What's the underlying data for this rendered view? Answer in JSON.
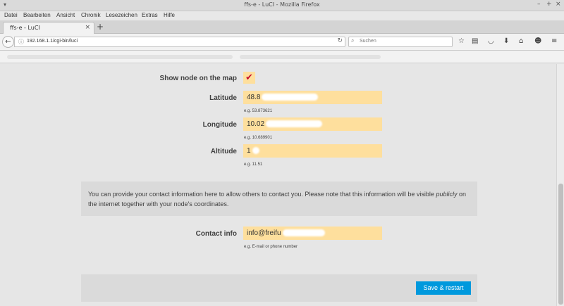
{
  "window": {
    "title": "ffs-e          - LuCI - Mozilla Firefox",
    "controls": [
      "–",
      "+",
      "×"
    ]
  },
  "menubar": [
    "Datei",
    "Bearbeiten",
    "Ansicht",
    "Chronik",
    "Lesezeichen",
    "Extras",
    "Hilfe"
  ],
  "tabs": [
    {
      "title": "ffs-e          - LuCI"
    }
  ],
  "newtab_label": "+",
  "navbar": {
    "url": "192.168.1.1/cgi-bin/luci",
    "search_placeholder": "Suchen",
    "icons": [
      "bookmark-star-icon",
      "library-icon",
      "pocket-icon",
      "download-icon",
      "home-icon",
      "emoji-icon",
      "hamburger-menu-icon"
    ]
  },
  "form": {
    "show_on_map": {
      "label": "Show node on the map",
      "checked": true,
      "mark": "✔"
    },
    "latitude": {
      "label": "Latitude",
      "value": "48.8",
      "hint": "e.g. 53.873621"
    },
    "longitude": {
      "label": "Longitude",
      "value": "10.02",
      "hint": "e.g. 10.689901"
    },
    "altitude": {
      "label": "Altitude",
      "value": "1",
      "hint": "e.g. 11.51"
    },
    "info_text_before": "You can provide your contact information here to allow others to contact you. Please note that this information will be visible ",
    "info_text_em": "publicly",
    "info_text_after": " on the internet together with your node's coordinates.",
    "contact": {
      "label": "Contact info",
      "value": "info@freifu",
      "hint": "e.g. E-mail or phone number"
    },
    "save_label": "Save & restart"
  },
  "colors": {
    "field_bg": "#fedf9d",
    "checkmark": "#c8102e",
    "button": "#0099dd"
  }
}
